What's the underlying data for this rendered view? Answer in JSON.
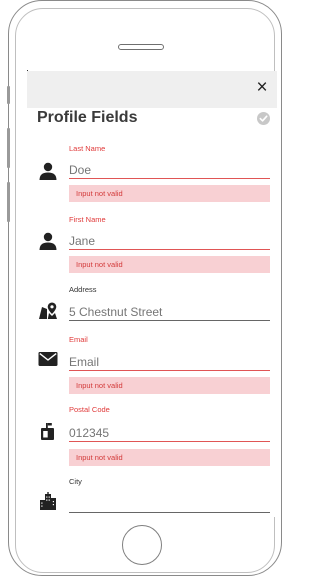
{
  "header": {
    "close_glyph": "×"
  },
  "page": {
    "title": "Profile Fields"
  },
  "fields": [
    {
      "label": "Last Name",
      "placeholder": "Doe",
      "error": "Input not valid",
      "icon": "person-icon"
    },
    {
      "label": "First Name",
      "placeholder": "Jane",
      "error": "Input not valid",
      "icon": "person-icon"
    },
    {
      "label": "Address",
      "placeholder": "5 Chestnut Street",
      "error": "",
      "icon": "map-pin-icon"
    },
    {
      "label": "Email",
      "placeholder": "Email",
      "error": "Input not valid",
      "icon": "envelope-icon"
    },
    {
      "label": "Postal Code",
      "placeholder": "012345",
      "error": "Input not valid",
      "icon": "mailbox-icon"
    },
    {
      "label": "City",
      "placeholder": "",
      "error": "",
      "icon": "city-icon"
    }
  ],
  "colors": {
    "error": "#e03a3a",
    "error_bg": "#f8d0d3",
    "header_bg": "#efefef"
  }
}
